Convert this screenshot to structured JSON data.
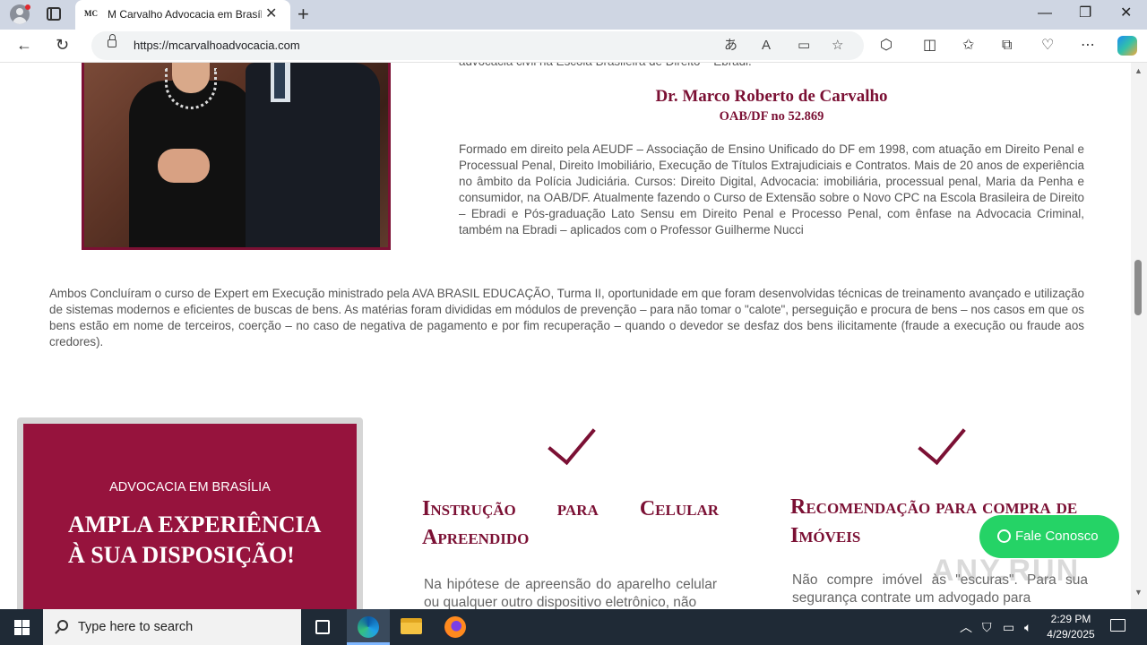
{
  "browser": {
    "tab_title": "M Carvalho Advocacia em Brasília",
    "tab_favicon": "MC",
    "tab_close": "✕",
    "new_tab": "+",
    "url": "https://mcarvalhoadvocacia.com",
    "window_controls": {
      "minimize": "—",
      "maximize": "❐",
      "close": "✕"
    },
    "icons": [
      "profile-icon",
      "tab-actions-icon",
      "back-icon",
      "refresh-icon",
      "lock-icon",
      "translate-icon",
      "read-aloud-icon",
      "immersive-reader-icon",
      "favorite-star-icon",
      "extensions-icon",
      "split-screen-icon",
      "favorites-icon",
      "collections-icon",
      "browser-essentials-icon",
      "more-icon",
      "copilot-icon"
    ]
  },
  "page": {
    "bio_cut_line": "advocacia civil na Escola Brasileira de Direito – Ebradi.",
    "person_name": "Dr. Marco Roberto de Carvalho",
    "person_oab": "OAB/DF no 52.869",
    "bio_text": "Formado em direito pela AEUDF – Associação de Ensino Unificado do DF em 1998, com atuação em Direito Penal e Processual Penal, Direito Imobiliário, Execução de Títulos Extrajudiciais e Contratos. Mais de 20 anos de experiência no âmbito da Polícia Judiciária. Cursos: Direito Digital, Advocacia: imobiliária, processual penal, Maria da Penha e consumidor, na OAB/DF. Atualmente fazendo o Curso de Extensão sobre o Novo CPC na Escola Brasileira de Direito – Ebradi e Pós-graduação Lato Sensu em Direito Penal e Processo Penal, com ênfase na Advocacia Criminal, também na Ebradi – aplicados com o Professor Guilherme Nucci",
    "both_text": "Ambos Concluíram o curso de Expert em Execução ministrado pela AVA BRASIL EDUCAÇÃO, Turma II, oportunidade em que foram desenvolvidas técnicas de treinamento avançado e utilização de sistemas modernos e eficientes de buscas de bens. As matérias foram divididas em módulos de prevenção – para não tomar o \"calote\", perseguição e procura de bens – nos casos em que os bens estão em nome de terceiros, coerção – no caso de negativa de pagamento e por fim recuperação – quando o devedor se desfaz dos bens ilicitamente (fraude a execução ou fraude aos credores).",
    "card": {
      "kicker": "ADVOCACIA EM BRASÍLIA",
      "heading": "AMPLA EXPERIÊNCIA À SUA DISPOSIÇÃO!"
    },
    "features": [
      {
        "title": "Instrução para Celular Apreendido",
        "text": "Na hipótese de apreensão do aparelho celular ou qualquer outro dispositivo eletrônico, não"
      },
      {
        "title": "Recomendação para compra de Imóveis",
        "text": "Não compre imóvel às \"escuras\". Para sua segurança contrate um advogado para"
      }
    ],
    "whatsapp_button": "Fale Conosco",
    "watermark": "ANY.RUN"
  },
  "taskbar": {
    "search_placeholder": "Type here to search",
    "clock_time": "2:29 PM",
    "clock_date": "4/29/2025",
    "apps": [
      "task-view-icon",
      "edge-icon",
      "file-explorer-icon",
      "firefox-icon"
    ]
  },
  "colors": {
    "brand": "#96133d",
    "brand_text": "#7b1034",
    "whatsapp": "#25d366",
    "tabstrip": "#cfd6e3",
    "taskbar": "#1f2a36"
  }
}
